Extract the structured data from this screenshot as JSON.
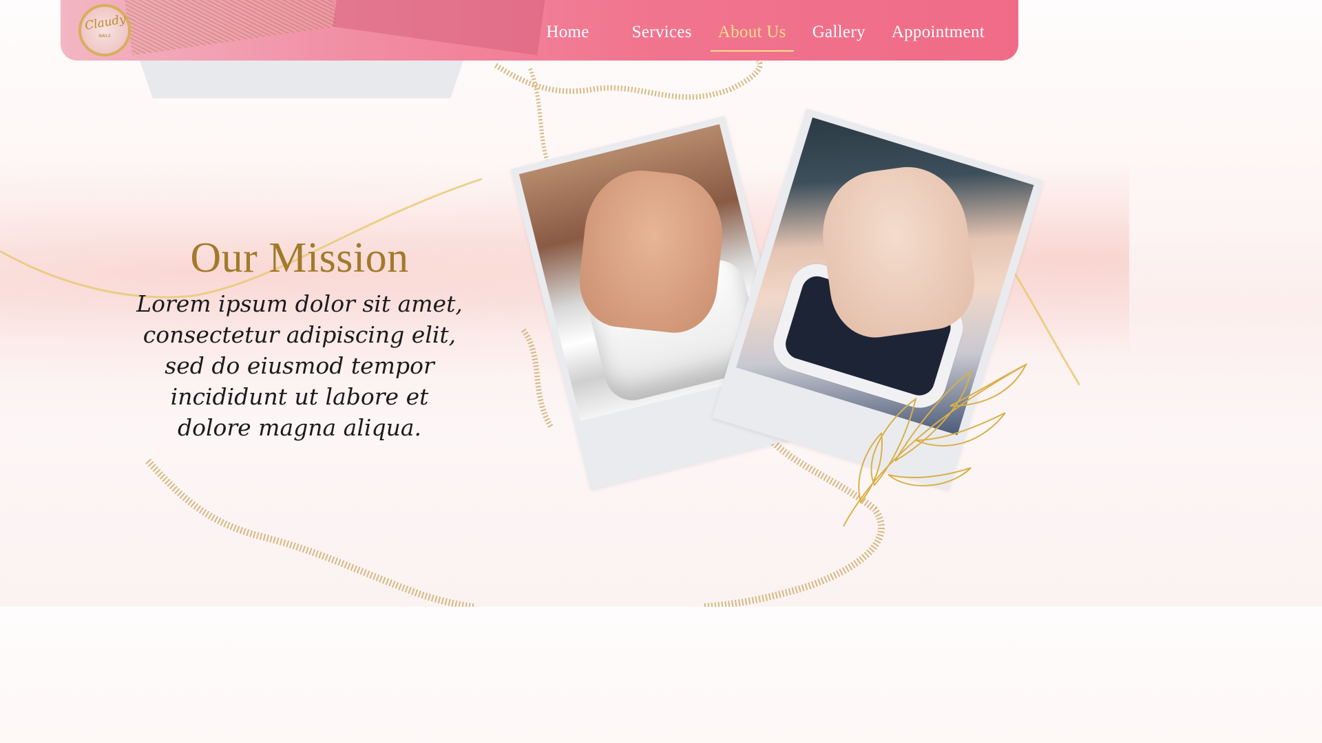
{
  "brand": {
    "logo_text": "Claudy",
    "logo_sub": "NAILS"
  },
  "nav": {
    "items": [
      {
        "label": "Home",
        "active": false
      },
      {
        "label": "Services",
        "active": false
      },
      {
        "label": "About Us",
        "active": true
      },
      {
        "label": "Gallery",
        "active": false
      },
      {
        "label": "Appointment",
        "active": false
      }
    ]
  },
  "mission": {
    "title": "Our Mission",
    "body": "Lorem ipsum dolor sit amet, consectetur adipiscing elit, sed do eiusmod tempor incididunt ut labore et dolore magna aliqua."
  },
  "colors": {
    "navbar": "#f1758f",
    "active_link": "#f8df8a",
    "title_gold": "#a27a2a",
    "glitter_gold": "#c9a35a"
  },
  "icons": [
    "logo-emblem-icon",
    "gold-leaf-icon"
  ]
}
